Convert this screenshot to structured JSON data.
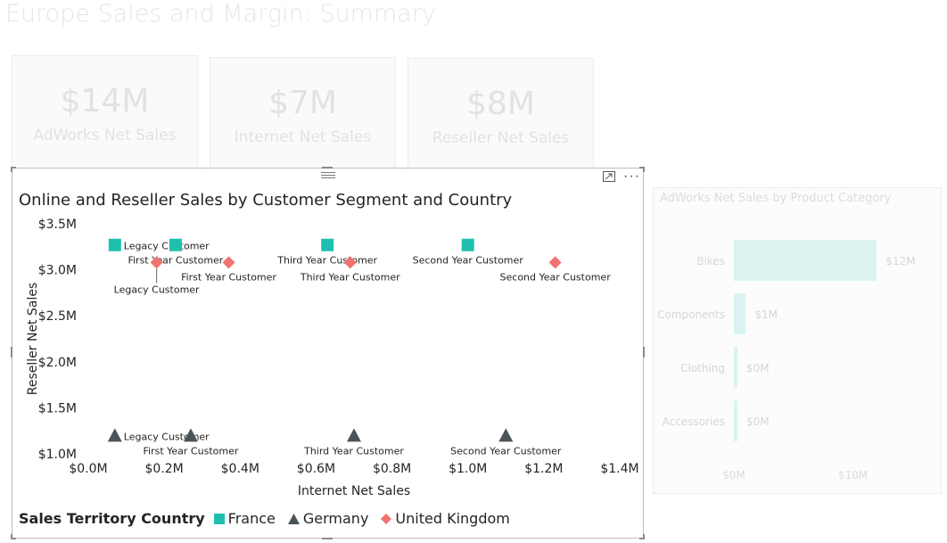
{
  "page": {
    "title": "Europe Sales and Margin: Summary"
  },
  "cards": [
    {
      "value": "$14M",
      "label": "AdWorks Net Sales"
    },
    {
      "value": "$7M",
      "label": "Internet Net Sales"
    },
    {
      "value": "$8M",
      "label": "Reseller Net Sales"
    }
  ],
  "scatter_visual": {
    "more_label": "···",
    "legend": {
      "title": "Sales Territory Country",
      "items": [
        {
          "name": "France",
          "color": "#1FBFB0",
          "icon": "square-icon"
        },
        {
          "name": "Germany",
          "color": "#4A5358",
          "icon": "triangle-icon"
        },
        {
          "name": "United Kingdom",
          "color": "#F2726F",
          "icon": "diamond-icon"
        }
      ]
    }
  },
  "bar_visual": {
    "title": "AdWorks Net Sales by Product Category"
  },
  "chart_data": [
    {
      "type": "scatter",
      "title": "Online and Reseller Sales by Customer Segment and Country",
      "xlabel": "Internet Net Sales",
      "ylabel": "Reseller Net Sales",
      "xlim": [
        0,
        1.4
      ],
      "ylim": [
        1.0,
        3.5
      ],
      "x_ticks": [
        "$0.0M",
        "$0.2M",
        "$0.4M",
        "$0.6M",
        "$0.8M",
        "$1.0M",
        "$1.2M",
        "$1.4M"
      ],
      "y_ticks": [
        "$1.0M",
        "$1.5M",
        "$2.0M",
        "$2.5M",
        "$3.0M",
        "$3.5M"
      ],
      "legend_position": "bottom-left",
      "series": [
        {
          "name": "France",
          "color": "#1FBFB0",
          "marker": "square",
          "points": [
            {
              "x": 0.07,
              "y": 3.27,
              "label": "Legacy Customer"
            },
            {
              "x": 0.23,
              "y": 3.27,
              "label": "First Year Customer"
            },
            {
              "x": 0.63,
              "y": 3.27,
              "label": "Third Year Customer"
            },
            {
              "x": 1.0,
              "y": 3.27,
              "label": "Second Year Customer"
            }
          ]
        },
        {
          "name": "Germany",
          "color": "#4A5358",
          "marker": "triangle",
          "points": [
            {
              "x": 0.07,
              "y": 1.2,
              "label": "Legacy Customer"
            },
            {
              "x": 0.27,
              "y": 1.2,
              "label": "First Year Customer"
            },
            {
              "x": 0.7,
              "y": 1.2,
              "label": "Third Year Customer"
            },
            {
              "x": 1.1,
              "y": 1.2,
              "label": "Second Year Customer"
            }
          ]
        },
        {
          "name": "United Kingdom",
          "color": "#F2726F",
          "marker": "diamond",
          "points": [
            {
              "x": 0.18,
              "y": 3.08,
              "label": "Legacy Customer"
            },
            {
              "x": 0.37,
              "y": 3.08,
              "label": "First Year Customer"
            },
            {
              "x": 0.69,
              "y": 3.08,
              "label": "Third Year Customer"
            },
            {
              "x": 1.23,
              "y": 3.08,
              "label": "Second Year Customer"
            }
          ]
        }
      ]
    },
    {
      "type": "bar",
      "orientation": "horizontal",
      "title": "AdWorks Net Sales by Product Category",
      "categories": [
        "Bikes",
        "Components",
        "Clothing",
        "Accessories"
      ],
      "values": [
        12,
        1,
        0,
        0
      ],
      "data_labels": [
        "$12M",
        "$1M",
        "$0M",
        "$0M"
      ],
      "x_ticks": [
        "$0M",
        "$10M"
      ],
      "xlim": [
        0,
        17
      ],
      "color": "#9EE5DF"
    }
  ]
}
